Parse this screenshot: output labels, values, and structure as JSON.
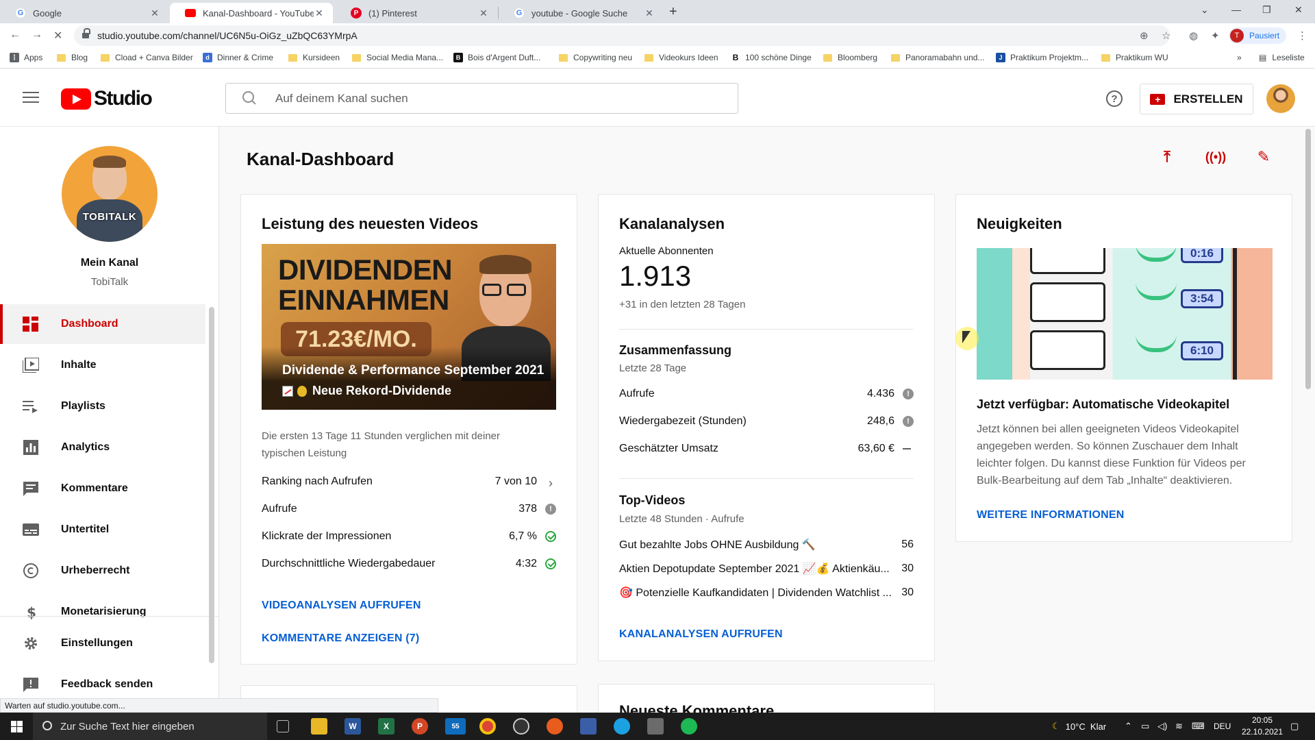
{
  "browser": {
    "tabs": [
      {
        "title": "Google",
        "favicon": "google-icon"
      },
      {
        "title": "Kanal-Dashboard - YouTube Studio",
        "favicon": "youtube-icon",
        "active": true
      },
      {
        "title": "(1) Pinterest",
        "favicon": "pinterest-icon"
      },
      {
        "title": "youtube - Google Suche",
        "favicon": "google-icon"
      }
    ],
    "url": "studio.youtube.com/channel/UC6N5u-OiGz_uZbQC63YMrpA",
    "profile_initial": "T",
    "profile_status": "Pausiert",
    "bookmarks": [
      "Apps",
      "Blog",
      "Cload + Canva Bilder",
      "Dinner & Crime",
      "Kursideen",
      "Social Media Mana...",
      "Bois d'Argent Duft...",
      "Copywriting neu",
      "Videokurs Ideen",
      "100 schöne Dinge",
      "Bloomberg",
      "Panoramabahn und...",
      "Praktikum Projektm...",
      "Praktikum WU"
    ],
    "reading_list": "Leseliste",
    "status_text": "Warten auf studio.youtube.com..."
  },
  "header": {
    "logo_text": "Studio",
    "search_placeholder": "Auf deinem Kanal suchen",
    "create_label": "ERSTELLEN"
  },
  "sidebar": {
    "channel_label": "Mein Kanal",
    "channel_name": "TobiTalk",
    "avatar_text": "TOBITALK",
    "items": [
      {
        "label": "Dashboard",
        "icon": "dashboard-icon",
        "active": true
      },
      {
        "label": "Inhalte",
        "icon": "content-icon"
      },
      {
        "label": "Playlists",
        "icon": "playlist-icon"
      },
      {
        "label": "Analytics",
        "icon": "analytics-icon"
      },
      {
        "label": "Kommentare",
        "icon": "comments-icon"
      },
      {
        "label": "Untertitel",
        "icon": "subtitles-icon"
      },
      {
        "label": "Urheberrecht",
        "icon": "copyright-icon"
      },
      {
        "label": "Monetarisierung",
        "icon": "dollar-icon"
      },
      {
        "label": "Einstellungen",
        "icon": "gear-icon"
      },
      {
        "label": "Feedback senden",
        "icon": "feedback-icon"
      }
    ]
  },
  "main": {
    "page_title": "Kanal-Dashboard",
    "latest_video": {
      "title": "Leistung des neuesten Videos",
      "thumb_line1": "DIVIDENDEN",
      "thumb_line2": "EINNAHMEN",
      "thumb_amount": "71.23€/MO.",
      "caption1": "Dividende & Performance September 2021",
      "caption2": "Neue Rekord-Dividende",
      "description": "Die ersten 13 Tage 11 Stunden verglichen mit deiner typischen Leistung",
      "rows": [
        {
          "label": "Ranking nach Aufrufen",
          "value": "7 von 10",
          "icon": "chevron-right-icon"
        },
        {
          "label": "Aufrufe",
          "value": "378",
          "icon": "info-icon"
        },
        {
          "label": "Klickrate der Impressionen",
          "value": "6,7 %",
          "icon": "check-icon"
        },
        {
          "label": "Durchschnittliche Wiedergabedauer",
          "value": "4:32",
          "icon": "check-icon"
        }
      ],
      "link_analytics": "VIDEOANALYSEN AUFRUFEN",
      "link_comments": "KOMMENTARE ANZEIGEN (7)"
    },
    "channel_analytics": {
      "title": "Kanalanalysen",
      "subs_label": "Aktuelle Abonnenten",
      "subs_value": "1.913",
      "subs_change": "+31 in den letzten 28 Tagen",
      "summary_title": "Zusammenfassung",
      "summary_period": "Letzte 28 Tage",
      "summary_rows": [
        {
          "label": "Aufrufe",
          "value": "4.436",
          "icon": "info-icon"
        },
        {
          "label": "Wiedergabezeit (Stunden)",
          "value": "248,6",
          "icon": "info-icon"
        },
        {
          "label": "Geschätzter Umsatz",
          "value": "63,60 €",
          "icon": "dash-icon"
        }
      ],
      "top_title": "Top-Videos",
      "top_period": "Letzte 48 Stunden · Aufrufe",
      "top_rows": [
        {
          "label": "Gut bezahlte Jobs OHNE Ausbildung 🔨",
          "value": "56"
        },
        {
          "label": "Aktien Depotupdate September 2021 📈💰 Aktienkäu...",
          "value": "30"
        },
        {
          "label": "🎯 Potenzielle Kaufkandidaten | Dividenden Watchlist ...",
          "value": "30"
        }
      ],
      "link": "KANALANALYSEN AUFRUFEN",
      "next_card_title": "Neueste Kommentare"
    },
    "news": {
      "title": "Neuigkeiten",
      "times": [
        "0:16",
        "3:54",
        "6:10"
      ],
      "headline": "Jetzt verfügbar: Automatische Videokapitel",
      "body": "Jetzt können bei allen geeigneten Videos Videokapitel angegeben werden. So können Zuschauer dem Inhalt leichter folgen. Du kannst diese Funktion für Videos per Bulk-Bearbeitung auf dem Tab „Inhalte“ deaktivieren.",
      "link": "WEITERE INFORMATIONEN"
    }
  },
  "taskbar": {
    "search_placeholder": "Zur Suche Text hier eingeben",
    "mail_badge": "55",
    "weather": "10°C  Klar",
    "language": "DEU",
    "time": "20:05",
    "date": "22.10.2021"
  },
  "colors": {
    "accent_red": "#cc0000",
    "link_blue": "#065fd4",
    "check_green": "#2ba640"
  }
}
